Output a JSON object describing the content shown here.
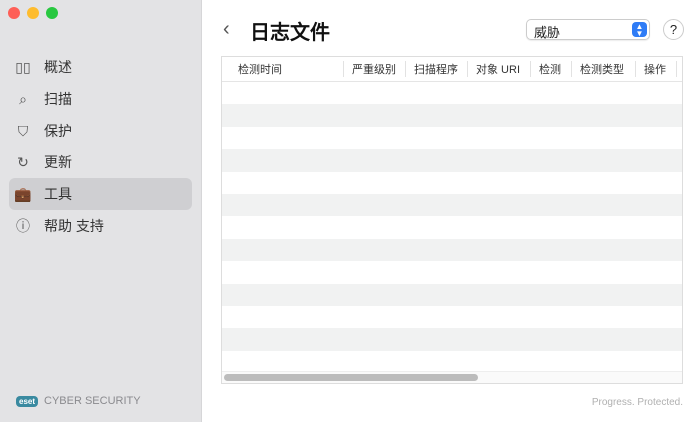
{
  "sidebar": {
    "items": [
      {
        "label": "概述",
        "icon": "dashboard-icon"
      },
      {
        "label": "扫描",
        "icon": "search-icon"
      },
      {
        "label": "保护",
        "icon": "shield-icon"
      },
      {
        "label": "更新",
        "icon": "refresh-icon"
      },
      {
        "label": "工具",
        "icon": "briefcase-icon",
        "active": true
      },
      {
        "label": "帮助 支持",
        "icon": "help-icon"
      }
    ],
    "brand_logo": "eset",
    "brand_text": "CYBER SECURITY"
  },
  "header": {
    "title": "日志文件",
    "filter_value": "威胁",
    "help": "?"
  },
  "table": {
    "columns": [
      "检测时间",
      "严重级别",
      "扫描程序",
      "对象 URI",
      "检测",
      "检测类型",
      "操作"
    ]
  },
  "footer": {
    "tagline": "Progress. Protected."
  }
}
